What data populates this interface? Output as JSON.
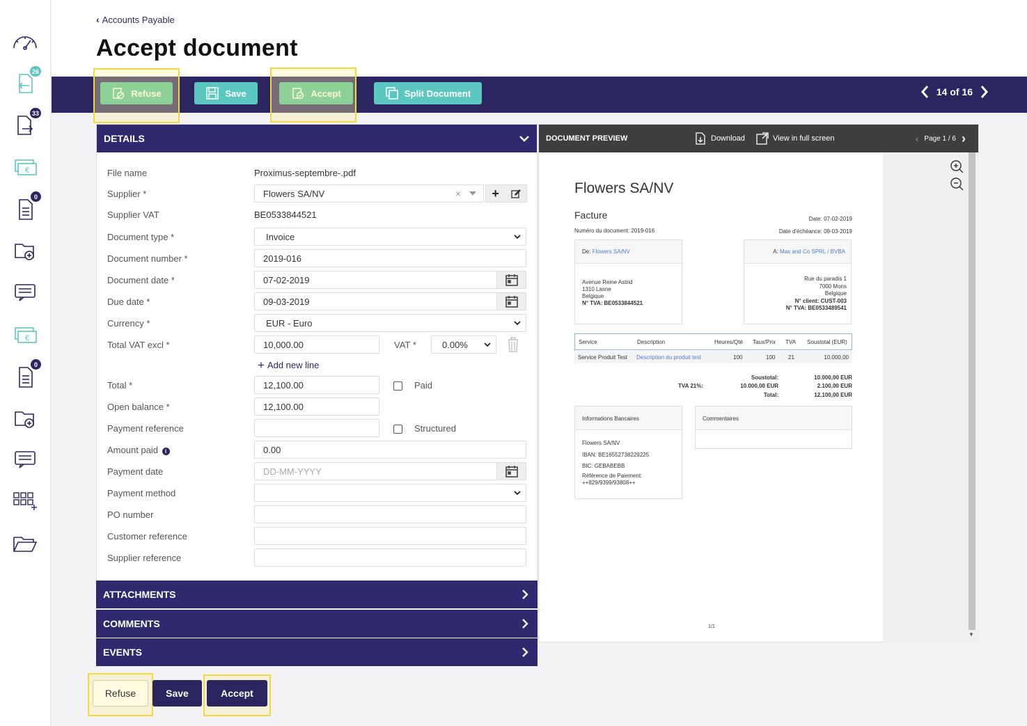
{
  "sidebar": {
    "badges": {
      "incoming": "26",
      "outgoing": "33",
      "doc1": "0",
      "doc2": "0"
    },
    "colors": {
      "teal": "#5bc7c0",
      "dark": "#2b2660"
    }
  },
  "header": {
    "breadcrumb": "Accounts Payable",
    "title": "Accept document"
  },
  "toolbar": {
    "refuse": "Refuse",
    "save": "Save",
    "accept": "Accept",
    "split": "Split Document",
    "pager": "14 of 16"
  },
  "details": {
    "title": "DETAILS",
    "file_name_label": "File name",
    "file_name": "Proximus-septembre-.pdf",
    "supplier_label": "Supplier *",
    "supplier": "Flowers SA/NV",
    "supplier_vat_label": "Supplier VAT",
    "supplier_vat": "BE0533844521",
    "doc_type_label": "Document type *",
    "doc_type": "Invoice",
    "doc_number_label": "Document number *",
    "doc_number": "2019-016",
    "doc_date_label": "Document date *",
    "doc_date": "07-02-2019",
    "due_date_label": "Due date *",
    "due_date": "09-03-2019",
    "currency_label": "Currency *",
    "currency": "EUR - Euro",
    "total_vat_excl_label": "Total VAT excl *",
    "total_vat_excl": "10,000.00",
    "vat_label": "VAT *",
    "vat": "0.00%",
    "add_line": "Add new line",
    "total_label": "Total *",
    "total": "12,100.00",
    "paid_label": "Paid",
    "open_balance_label": "Open balance *",
    "open_balance": "12,100.00",
    "payment_ref_label": "Payment reference",
    "structured_label": "Structured",
    "amount_paid_label": "Amount paid",
    "amount_paid": "0.00",
    "payment_date_label": "Payment date",
    "payment_date_placeholder": "DD-MM-YYYY",
    "payment_method_label": "Payment method",
    "po_number_label": "PO number",
    "customer_ref_label": "Customer reference",
    "supplier_ref_label": "Supplier reference"
  },
  "sections": {
    "attachments": "ATTACHMENTS",
    "comments": "COMMENTS",
    "events": "EVENTS"
  },
  "bottom": {
    "refuse": "Refuse",
    "save": "Save",
    "accept": "Accept"
  },
  "preview": {
    "title": "DOCUMENT PREVIEW",
    "download": "Download",
    "fullscreen": "View in full screen",
    "page": "Page 1 / 6",
    "pdf": {
      "company": "Flowers SA/NV",
      "doc_kind": "Facture",
      "date": "Date: 07-02-2019",
      "doc_number": "Numéro du document: 2019-016",
      "due": "Date d'échéance: 09-03-2019",
      "from_label": "De:",
      "from_name": "Flowers SA/NV",
      "from_addr1": "Avenue Reine Astrid",
      "from_addr2": "1310 Lasne",
      "from_addr3": "Belgique",
      "from_vat": "N° TVA: BE0533844521",
      "to_label": "A:",
      "to_name": "Max and Co SPRL / BVBA",
      "to_addr1": "Rue du paradis 1",
      "to_addr2": "7000 Mons",
      "to_addr3": "Belgique",
      "to_client": "N° client: CUST-003",
      "to_vat": "N° TVA: BE0533489541",
      "th_service": "Service",
      "th_desc": "Description",
      "th_qty": "Heures/Qté",
      "th_rate": "Taux/Prix",
      "th_tva": "TVA",
      "th_sub": "Soustotal (EUR)",
      "row_service": "Service Produit Test",
      "row_desc": "Description du produit test",
      "row_qty": "100",
      "row_rate": "100",
      "row_tva": "21",
      "row_sub": "10.000,00",
      "soustotal_label": "Soustotal:",
      "soustotal": "10.000,00 EUR",
      "tva_label": "TVA 21%:",
      "tva_base": "10.000,00 EUR",
      "tva": "2.100,00 EUR",
      "total_label": "Total:",
      "total": "12.100,00 EUR",
      "bank_title": "Informations Bancaires",
      "bank_name": "Flowers SA/NV",
      "iban": "IBAN: BE16552738229225",
      "bic": "BIC: GEBABEBB",
      "payref": "Référence de Paiement: ++829/9399/93808++",
      "comments_title": "Commentaires",
      "footer": "1/1"
    }
  }
}
